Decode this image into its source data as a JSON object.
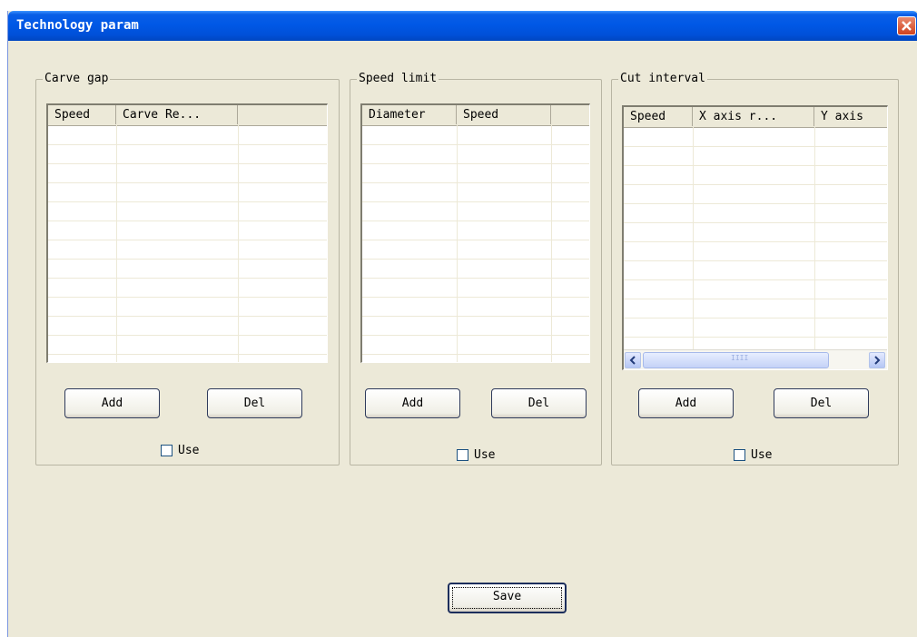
{
  "window": {
    "title": "Technology param"
  },
  "groups": {
    "carve": {
      "legend": "Carve gap",
      "columns": [
        "Speed",
        "Carve Re...",
        ""
      ],
      "add": "Add",
      "del": "Del",
      "use": "Use"
    },
    "speed": {
      "legend": "Speed limit",
      "columns": [
        "Diameter",
        "Speed",
        ""
      ],
      "add": "Add",
      "del": "Del",
      "use": "Use"
    },
    "cut": {
      "legend": "Cut interval",
      "columns": [
        "Speed",
        "X axis r...",
        "Y axis"
      ],
      "add": "Add",
      "del": "Del",
      "use": "Use",
      "scroll_thumb_grip": "IIII"
    }
  },
  "save": "Save"
}
